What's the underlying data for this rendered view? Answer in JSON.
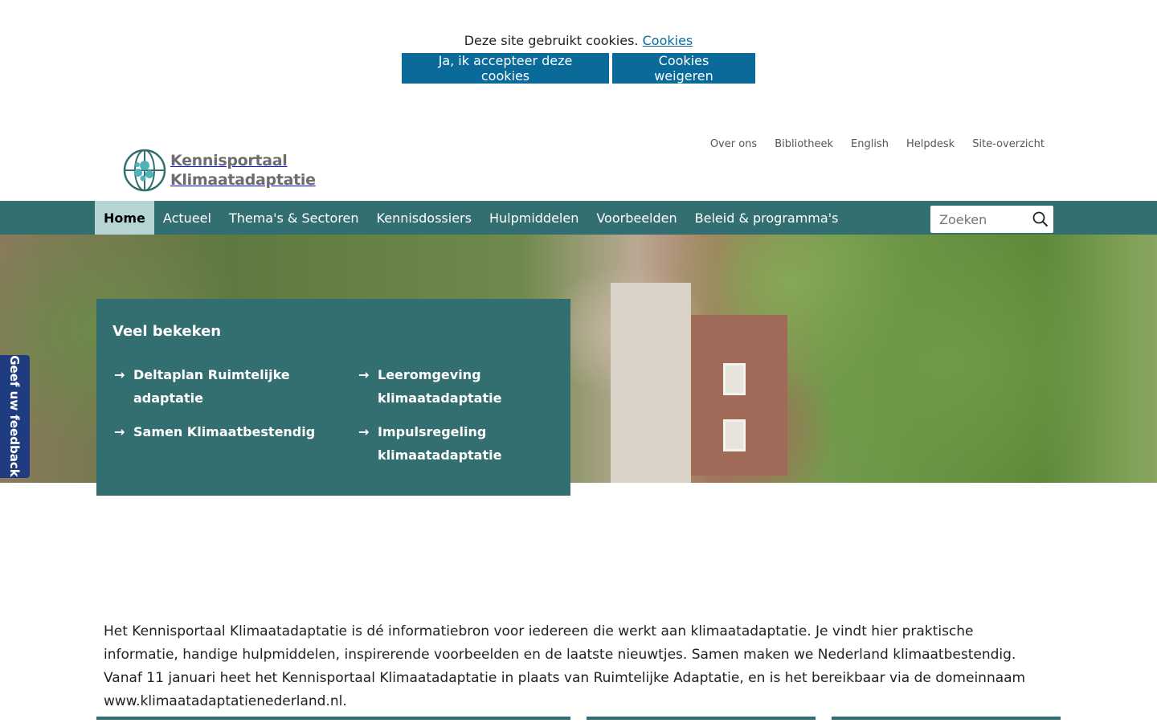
{
  "cookie": {
    "text": "Deze site gebruikt cookies.",
    "link": "Cookies",
    "accept_label": "Ja, ik accepteer deze cookies",
    "refuse_label": "Cookies weigeren"
  },
  "top_links": [
    "Over ons",
    "Bibliotheek",
    "English",
    "Helpdesk",
    "Site-overzicht"
  ],
  "logo": {
    "line1": "Kennisportaal",
    "line2": "Klimaatadaptatie"
  },
  "nav": {
    "items": [
      "Home",
      "Actueel",
      "Thema's & Sectoren",
      "Kennisdossiers",
      "Hulpmiddelen",
      "Voorbeelden",
      "Beleid & programma's"
    ],
    "active": "Home",
    "search_placeholder": "Zoeken"
  },
  "popular": {
    "title": "Veel bekeken",
    "links": [
      "Deltaplan Ruimtelijke adaptatie",
      "Leeromgeving klimaatadaptatie",
      "Samen Klimaatbestendig",
      "Impulsregeling klimaatadaptatie"
    ]
  },
  "feedback_label": "Geef uw feedback",
  "intro": "Het Kennisportaal Klimaatadaptatie is dé informatiebron voor iedereen die werkt aan klimaatadaptatie. Je vindt hier praktische informatie, handige hulpmiddelen, inspirerende voorbeelden en de laatste nieuwtjes. Samen maken we Nederland klimaatbestendig. Vanaf 11 januari heet het Kennisportaal Klimaatadaptatie in plaats van Ruimtelijke Adaptatie, en is het bereikbaar via de domeinnaam www.klimaatadaptatienederland.nl.",
  "colors": {
    "nav_bg": "#336e70",
    "nav_active_bg": "#b7d4d4",
    "cookie_button": "#0a6a9a",
    "feedback_bg": "#1f3c80"
  }
}
